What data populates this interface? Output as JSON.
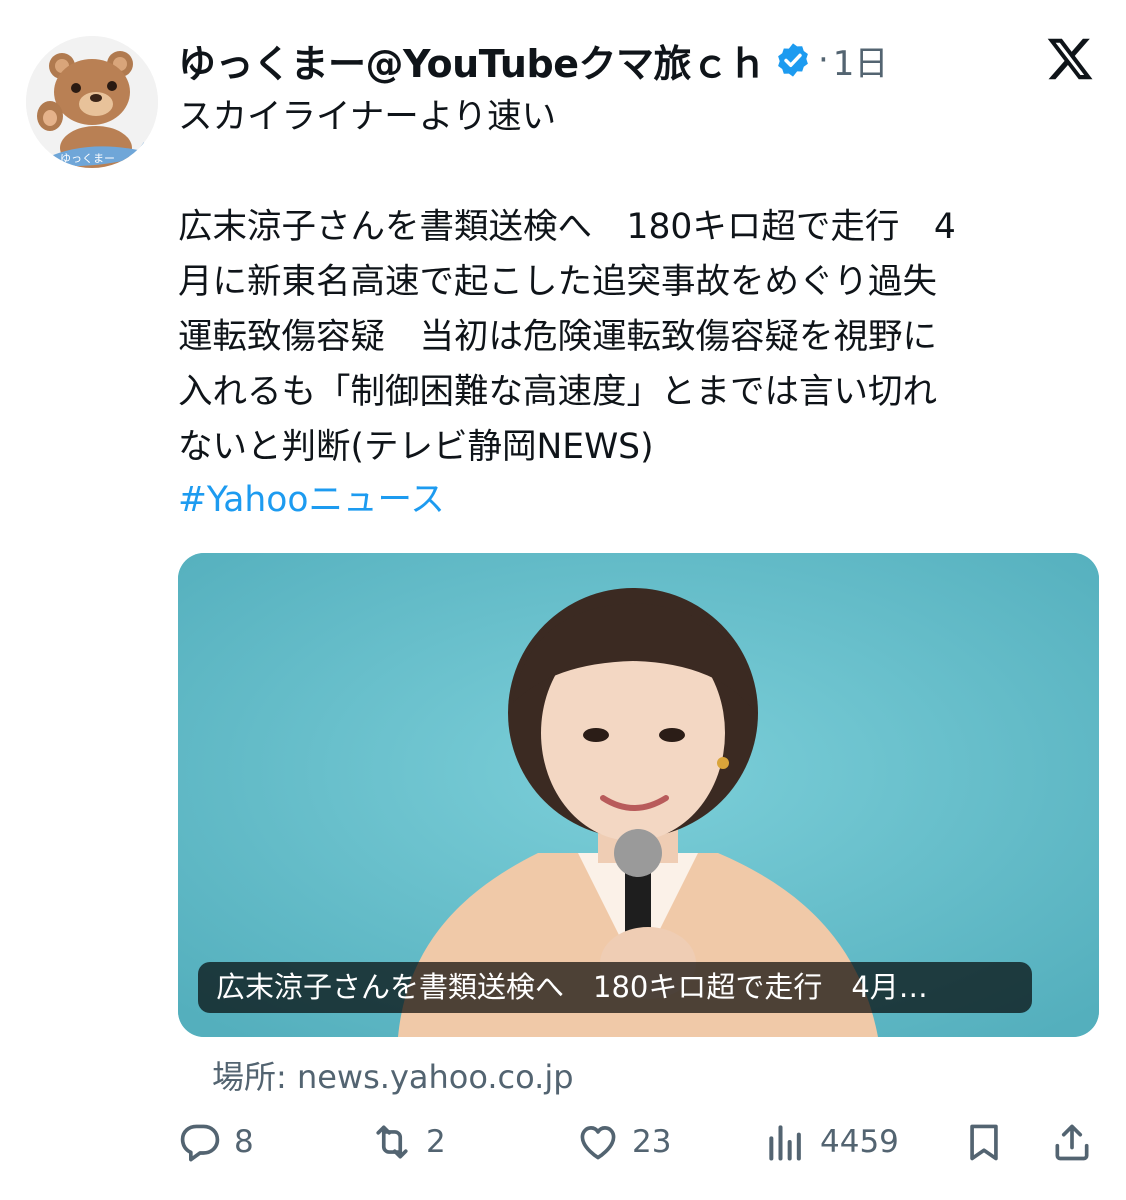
{
  "post": {
    "display_name": "ゆっくまー@YouTubeクマ旅ｃｈ",
    "separator": "·",
    "time": "1日",
    "text": "スカイライナーより速い\n\n広末涼子さんを書類送検へ　180キロ超で走行　4\n月に新東名高速で起こした追突事故をめぐり過失\n運転致傷容疑　当初は危険運転致傷容疑を視野に\n入れるも「制御困難な高速度」とまでは言い切れ\nないと判断(テレビ静岡NEWS)",
    "hashtag": "#Yahooニュース",
    "avatar_badge_text": "ゆっくまー"
  },
  "link_card": {
    "caption": "広末涼子さんを書類送検へ　180キロ超で走行　4月…",
    "source": "場所: news.yahoo.co.jp"
  },
  "actions": {
    "replies": "8",
    "reposts": "2",
    "likes": "23",
    "views": "4459"
  },
  "colors": {
    "text": "#0f1419",
    "secondary": "#536471",
    "link": "#1d9bf0",
    "verified_badge": "#1d9bf0",
    "card_background": "#66bcc8"
  },
  "icons": {
    "verified": "verified-badge-icon",
    "logo": "x-logo-icon",
    "reply": "reply-icon",
    "repost": "repost-icon",
    "like": "heart-icon",
    "views": "views-chart-icon",
    "bookmark": "bookmark-icon",
    "share": "share-icon"
  }
}
